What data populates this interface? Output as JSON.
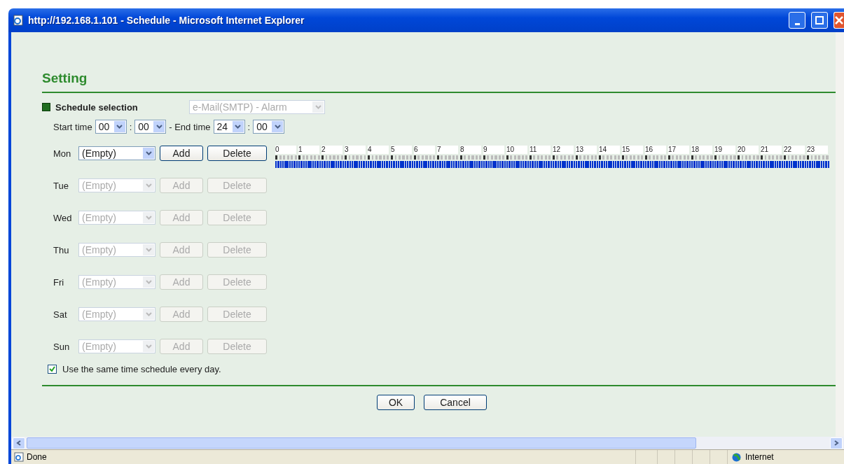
{
  "window": {
    "title": "http://192.168.1.101 - Schedule - Microsoft Internet Explorer"
  },
  "heading": "Setting",
  "schedule_selection": {
    "label": "Schedule selection",
    "value": "e-Mail(SMTP) - Alarm",
    "disabled": true
  },
  "time_range": {
    "start_label": "Start time",
    "start_hour": "00",
    "start_minute": "00",
    "end_label": "- End time",
    "end_hour": "24",
    "end_minute": "00",
    "separator": ":"
  },
  "hours": [
    "0",
    "1",
    "2",
    "3",
    "4",
    "5",
    "6",
    "7",
    "8",
    "9",
    "10",
    "11",
    "12",
    "13",
    "14",
    "15",
    "16",
    "17",
    "18",
    "19",
    "20",
    "21",
    "22",
    "23"
  ],
  "days": [
    {
      "day": "Mon",
      "value": "(Empty)",
      "disabled": false,
      "add": "Add",
      "delete": "Delete",
      "level": 1
    },
    {
      "day": "Tue",
      "value": "(Empty)",
      "disabled": true,
      "add": "Add",
      "delete": "Delete"
    },
    {
      "day": "Wed",
      "value": "(Empty)",
      "disabled": true,
      "add": "Add",
      "delete": "Delete"
    },
    {
      "day": "Thu",
      "value": "(Empty)",
      "disabled": true,
      "add": "Add",
      "delete": "Delete"
    },
    {
      "day": "Fri",
      "value": "(Empty)",
      "disabled": true,
      "add": "Add",
      "delete": "Delete"
    },
    {
      "day": "Sat",
      "value": "(Empty)",
      "disabled": true,
      "add": "Add",
      "delete": "Delete"
    },
    {
      "day": "Sun",
      "value": "(Empty)",
      "disabled": true,
      "add": "Add",
      "delete": "Delete"
    }
  ],
  "same_schedule": {
    "label": "Use the same time schedule every day.",
    "checked": true
  },
  "buttons": [
    "OK",
    "Cancel"
  ],
  "status_bar": {
    "text": "Done",
    "zone": "Internet"
  }
}
